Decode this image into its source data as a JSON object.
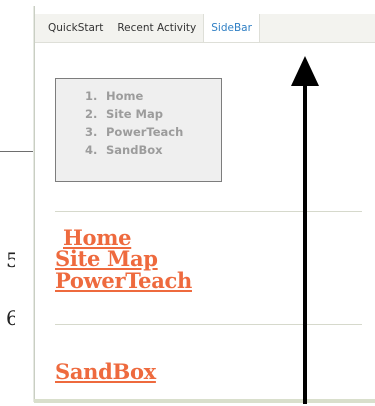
{
  "tabs": [
    {
      "label": "QuickStart",
      "active": false
    },
    {
      "label": "Recent Activity",
      "active": false
    },
    {
      "label": "SideBar",
      "active": true
    }
  ],
  "sidebar_menu": {
    "items": [
      {
        "num": "1.",
        "label": "Home"
      },
      {
        "num": "2.",
        "label": "Site Map"
      },
      {
        "num": "3.",
        "label": "PowerTeach"
      },
      {
        "num": "4.",
        "label": "SandBox"
      }
    ]
  },
  "links": {
    "home": "Home",
    "site_map": "Site Map",
    "powerteach": "PowerTeach",
    "sandbox": "SandBox"
  },
  "background_fragments": [
    "5",
    "6"
  ],
  "colors": {
    "accent_tab": "#2f7fc4",
    "link": "#ee6a3e",
    "menu_text": "#9c9c9c",
    "menu_bg": "#efefef",
    "arrow": "#000000"
  },
  "annotation": {
    "arrow_icon": "up-arrow-icon"
  }
}
